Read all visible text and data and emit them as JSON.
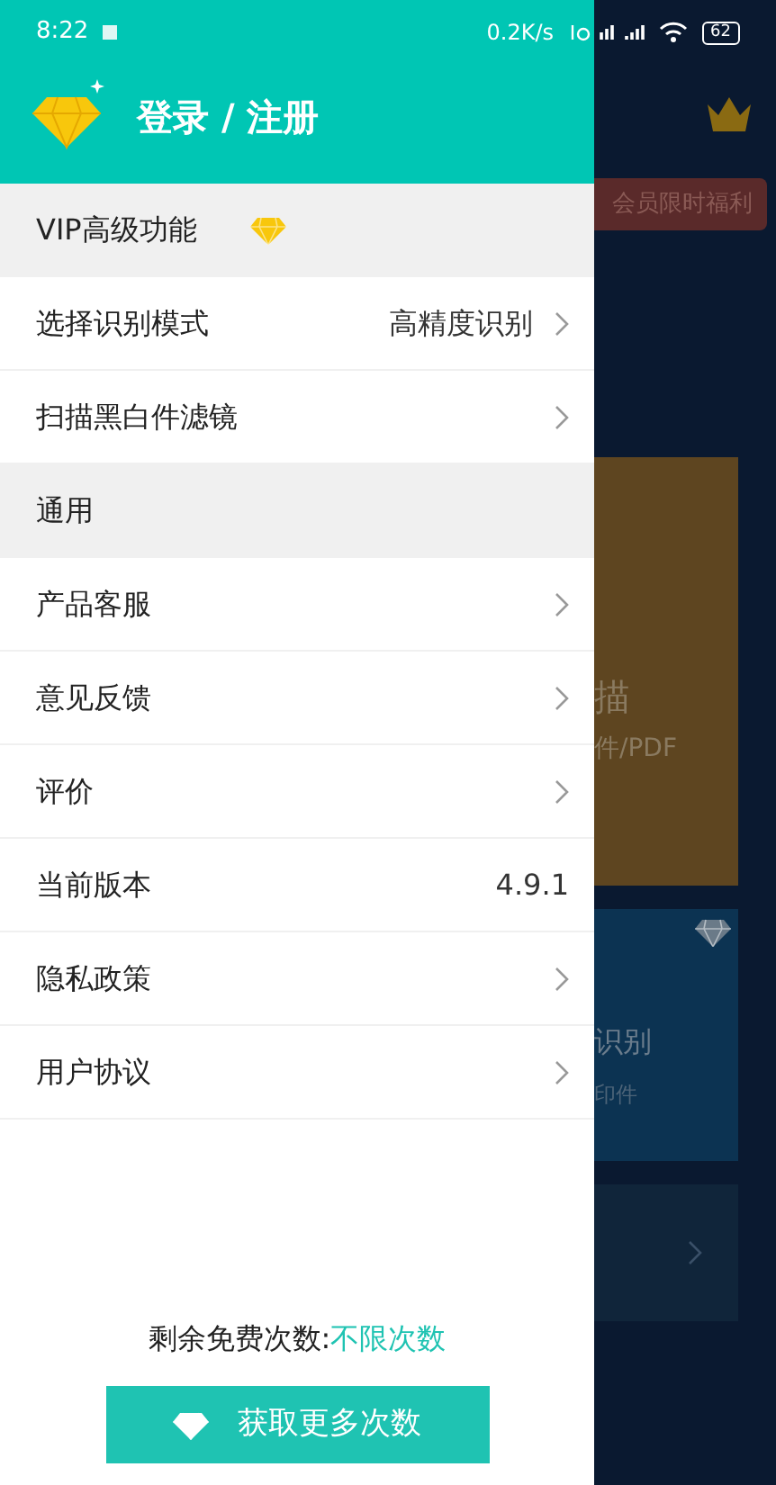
{
  "status_bar": {
    "time": "8:22",
    "speed": "0.2K/s",
    "battery": "62"
  },
  "drawer": {
    "title": "登录 / 注册",
    "rows": [
      {
        "kind": "section",
        "label": "VIP高级功能",
        "vip": true
      },
      {
        "kind": "item",
        "label": "选择识别模式",
        "value": "高精度识别",
        "chevron": true
      },
      {
        "kind": "item",
        "label": "扫描黑白件滤镜",
        "chevron": true
      },
      {
        "kind": "section",
        "label": "通用",
        "vip": false
      },
      {
        "kind": "item",
        "label": "产品客服",
        "chevron": true
      },
      {
        "kind": "item",
        "label": "意见反馈",
        "chevron": true
      },
      {
        "kind": "item",
        "label": "评价",
        "chevron": true
      },
      {
        "kind": "item",
        "label": "当前版本",
        "value": "4.9.1",
        "chevron": false
      },
      {
        "kind": "item",
        "label": "隐私政策",
        "chevron": true
      },
      {
        "kind": "item",
        "label": "用户协议",
        "chevron": true
      }
    ],
    "quota_label": "剩余免费次数:",
    "quota_value": "不限次数",
    "button": "获取更多次数"
  },
  "background": {
    "promo_tag": "会员限时福利",
    "scan_title": "描",
    "scan_subtitle": "件/PDF",
    "ocr_title": "识别",
    "ocr_subtitle": "印件"
  }
}
